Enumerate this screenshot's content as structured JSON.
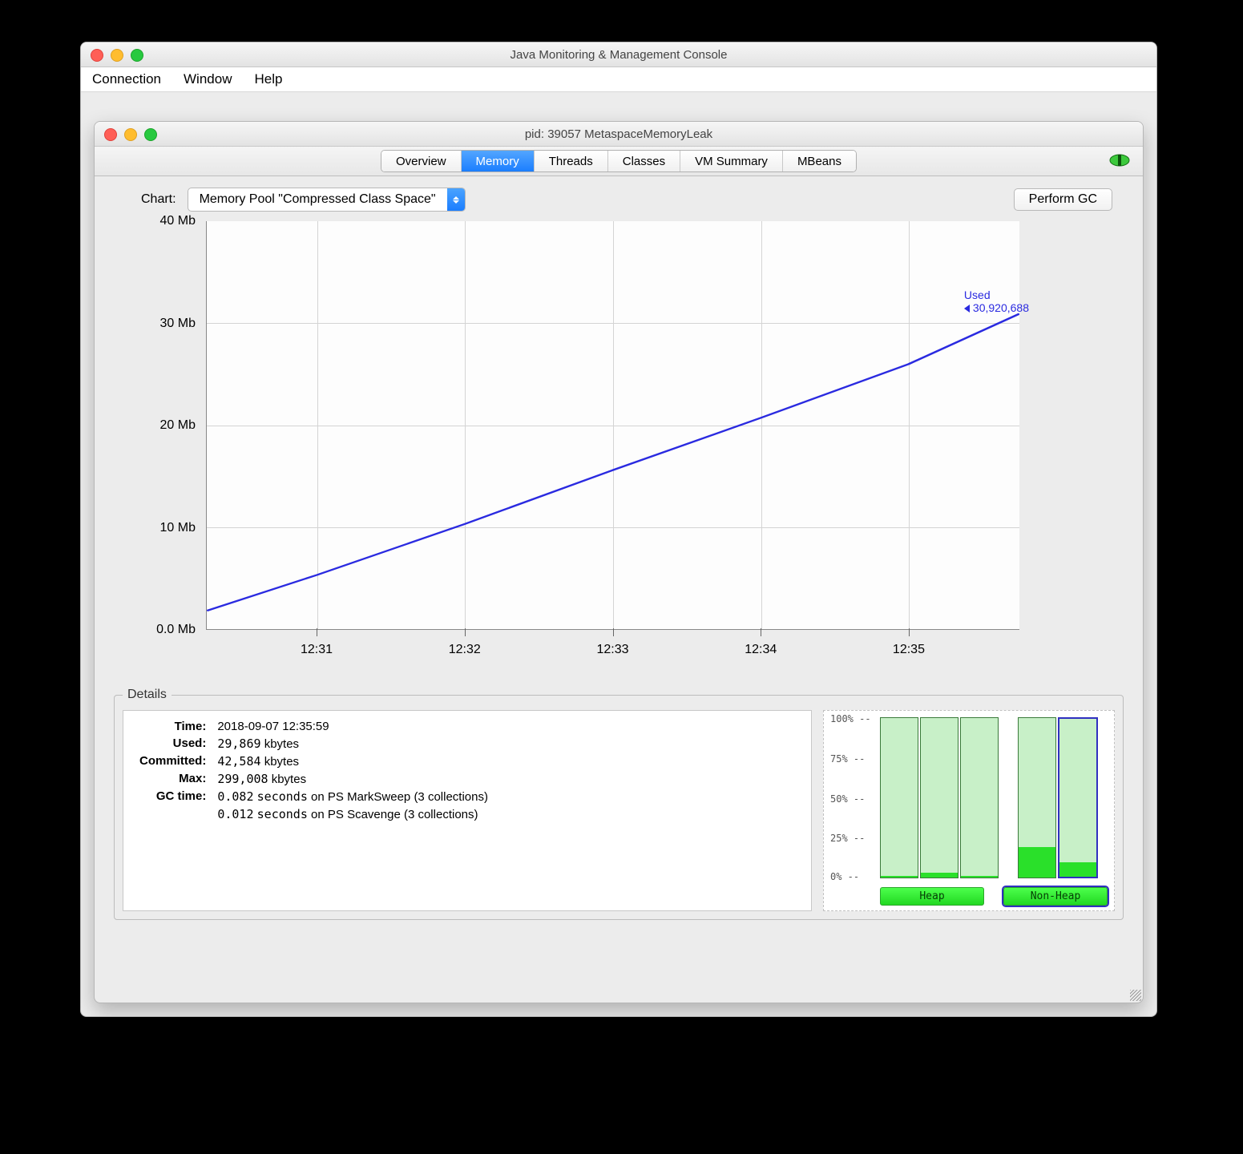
{
  "outer": {
    "title": "Java Monitoring & Management Console"
  },
  "menu": {
    "items": [
      "Connection",
      "Window",
      "Help"
    ]
  },
  "inner": {
    "title": "pid: 39057 MetaspaceMemoryLeak"
  },
  "tabs": {
    "items": [
      "Overview",
      "Memory",
      "Threads",
      "Classes",
      "VM Summary",
      "MBeans"
    ],
    "active": 1
  },
  "chart_controls": {
    "label": "Chart:",
    "selected": "Memory Pool \"Compressed Class Space\"",
    "gc_button": "Perform GC"
  },
  "chart_data": {
    "type": "line",
    "title": "",
    "xlabel": "",
    "ylabel": "",
    "ylim": [
      0,
      40
    ],
    "y_unit": "Mb",
    "y_ticks": [
      "0.0 Mb",
      "10 Mb",
      "20 Mb",
      "30 Mb",
      "40 Mb"
    ],
    "x_ticks": [
      "12:31",
      "12:32",
      "12:33",
      "12:34",
      "12:35"
    ],
    "series": [
      {
        "name": "Used",
        "color": "#2a2ae0",
        "x": [
          "12:30:15",
          "12:31",
          "12:32",
          "12:33",
          "12:34",
          "12:35",
          "12:35:45"
        ],
        "y": [
          1.8,
          5.3,
          10.3,
          15.6,
          20.7,
          26.0,
          30.9
        ]
      }
    ],
    "annotation": {
      "label": "Used",
      "value": "30,920,688"
    }
  },
  "details": {
    "legend": "Details",
    "rows": {
      "time": {
        "k": "Time:",
        "v": "2018-09-07 12:35:59"
      },
      "used": {
        "k": "Used:",
        "num": "29,869",
        "unit": "kbytes"
      },
      "committed": {
        "k": "Committed:",
        "num": "42,584",
        "unit": "kbytes"
      },
      "max": {
        "k": "Max:",
        "num": "299,008",
        "unit": "kbytes"
      },
      "gc1": {
        "k": "GC time:",
        "num": "0.082",
        "unit": "seconds",
        "suffix": "on PS MarkSweep (3 collections)"
      },
      "gc2": {
        "k": "",
        "num": "0.012",
        "unit": "seconds",
        "suffix": "on PS Scavenge (3 collections)"
      }
    }
  },
  "barchart": {
    "pct_labels": [
      "100%",
      "75%",
      "50%",
      "25%",
      "0%"
    ],
    "heap": {
      "label": "Heap",
      "bars": [
        1,
        3,
        1
      ]
    },
    "nonheap": {
      "label": "Non-Heap",
      "bars": [
        19,
        9
      ],
      "selected_bar": 1
    },
    "selected_group": "nonheap"
  }
}
